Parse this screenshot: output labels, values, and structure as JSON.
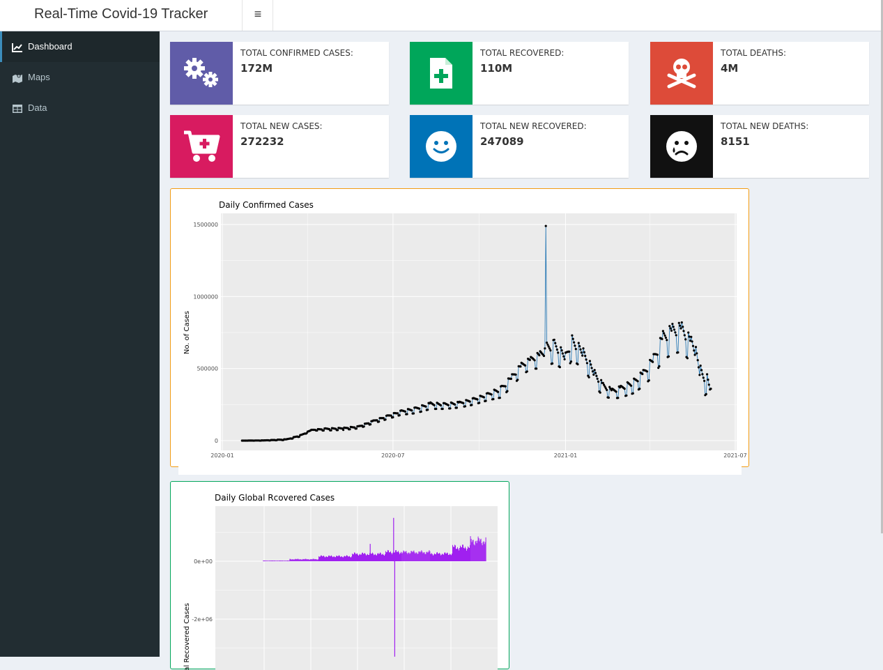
{
  "header": {
    "title": "Real-Time Covid-19 Tracker",
    "toggle_icon": "hamburger-icon",
    "toggle_glyph": "≡"
  },
  "sidebar": {
    "items": [
      {
        "label": "Dashboard",
        "icon": "line-chart-icon",
        "active": true
      },
      {
        "label": "Maps",
        "icon": "map-icon",
        "active": false
      },
      {
        "label": "Data",
        "icon": "table-icon",
        "active": false
      }
    ]
  },
  "info_boxes": [
    {
      "label": "TOTAL CONFIRMED CASES:",
      "value": "172M",
      "color": "#605ca8",
      "icon": "cogs-icon"
    },
    {
      "label": "TOTAL RECOVERED:",
      "value": "110M",
      "color": "#00a65a",
      "icon": "medical-file-icon"
    },
    {
      "label": "TOTAL DEATHS:",
      "value": "4M",
      "color": "#dd4b39",
      "icon": "skull-crossbones-icon"
    },
    {
      "label": "TOTAL NEW CASES:",
      "value": "272232",
      "color": "#d81b60",
      "icon": "cart-plus-icon"
    },
    {
      "label": "TOTAL NEW RECOVERED:",
      "value": "247089",
      "color": "#0073b7",
      "icon": "smile-icon"
    },
    {
      "label": "TOTAL NEW DEATHS:",
      "value": "8151",
      "color": "#111111",
      "icon": "sad-tear-icon"
    }
  ],
  "colors": {
    "panel1_border": "#f39c12",
    "panel2_border": "#00a65a",
    "line_series": "#2c7bb6",
    "bar_series": "#a020f0",
    "plot_bg": "#ebebeb"
  },
  "chart_data": [
    {
      "type": "line",
      "title": "Daily Confirmed Cases",
      "xlabel": "",
      "ylabel": "No. of Cases",
      "x_ticks": [
        "2020-01",
        "2020-07",
        "2021-01",
        "2021-07"
      ],
      "y_ticks": [
        "0",
        "500000",
        "1000000",
        "1500000"
      ],
      "xlim": [
        "2020-01-01",
        "2021-07-01"
      ],
      "ylim": [
        0,
        1500000
      ],
      "grid": true,
      "points": true,
      "series_name": "",
      "x": [
        "2020-01-22",
        "2020-02-15",
        "2020-03-10",
        "2020-03-25",
        "2020-04-05",
        "2020-04-20",
        "2020-05-10",
        "2020-05-25",
        "2020-06-10",
        "2020-06-25",
        "2020-07-10",
        "2020-07-25",
        "2020-08-10",
        "2020-08-25",
        "2020-09-10",
        "2020-09-25",
        "2020-10-10",
        "2020-10-25",
        "2020-11-05",
        "2020-11-15",
        "2020-11-25",
        "2020-12-05",
        "2020-12-10",
        "2020-12-11",
        "2020-12-12",
        "2020-12-20",
        "2021-01-01",
        "2021-01-08",
        "2021-01-20",
        "2021-02-01",
        "2021-02-10",
        "2021-02-20",
        "2021-03-01",
        "2021-03-15",
        "2021-03-25",
        "2021-04-05",
        "2021-04-15",
        "2021-04-25",
        "2021-05-05",
        "2021-05-15",
        "2021-05-20",
        "2021-05-25",
        "2021-06-01",
        "2021-06-05"
      ],
      "y": [
        0,
        2000,
        10000,
        40000,
        75000,
        85000,
        90000,
        100000,
        140000,
        175000,
        210000,
        230000,
        265000,
        260000,
        270000,
        295000,
        330000,
        380000,
        460000,
        540000,
        580000,
        620000,
        640000,
        1490000,
        680000,
        700000,
        610000,
        730000,
        640000,
        490000,
        400000,
        360000,
        380000,
        430000,
        490000,
        600000,
        760000,
        810000,
        820000,
        720000,
        650000,
        520000,
        460000,
        360000
      ],
      "y_min": [
        0,
        0,
        5000,
        30000,
        70000,
        70000,
        75000,
        85000,
        120000,
        150000,
        180000,
        190000,
        220000,
        220000,
        230000,
        250000,
        280000,
        300000,
        380000,
        450000,
        500000,
        500000,
        520000,
        1100000,
        520000,
        540000,
        480000,
        560000,
        500000,
        380000,
        310000,
        290000,
        300000,
        330000,
        380000,
        450000,
        560000,
        600000,
        620000,
        540000,
        480000,
        280000,
        330000,
        270000
      ]
    },
    {
      "type": "bar",
      "title": "Daily Global Rcovered Cases",
      "xlabel": "",
      "ylabel": "Total Recovered Cases",
      "y_ticks": [
        "0e+00",
        "-2e+06"
      ],
      "ylim": [
        -3300000,
        1600000
      ],
      "grid": true,
      "series_name": "",
      "segments": [
        {
          "x_start": 0.0,
          "x_end": 0.12,
          "value": 20000
        },
        {
          "x_start": 0.12,
          "x_end": 0.25,
          "value": 70000
        },
        {
          "x_start": 0.25,
          "x_end": 0.4,
          "value": 170000
        },
        {
          "x_start": 0.4,
          "x_end": 0.55,
          "value": 250000
        },
        {
          "x_start": 0.55,
          "x_end": 0.62,
          "value": 320000
        },
        {
          "x_start": 0.62,
          "x_end": 0.75,
          "value": 310000
        },
        {
          "x_start": 0.75,
          "x_end": 0.85,
          "value": 260000
        },
        {
          "x_start": 0.85,
          "x_end": 0.93,
          "value": 480000
        },
        {
          "x_start": 0.93,
          "x_end": 1.0,
          "value": 700000
        }
      ],
      "spikes": [
        {
          "x": 0.48,
          "value": 600000
        },
        {
          "x": 0.585,
          "value": 1500000
        },
        {
          "x": 0.59,
          "value": -3300000
        }
      ]
    }
  ]
}
